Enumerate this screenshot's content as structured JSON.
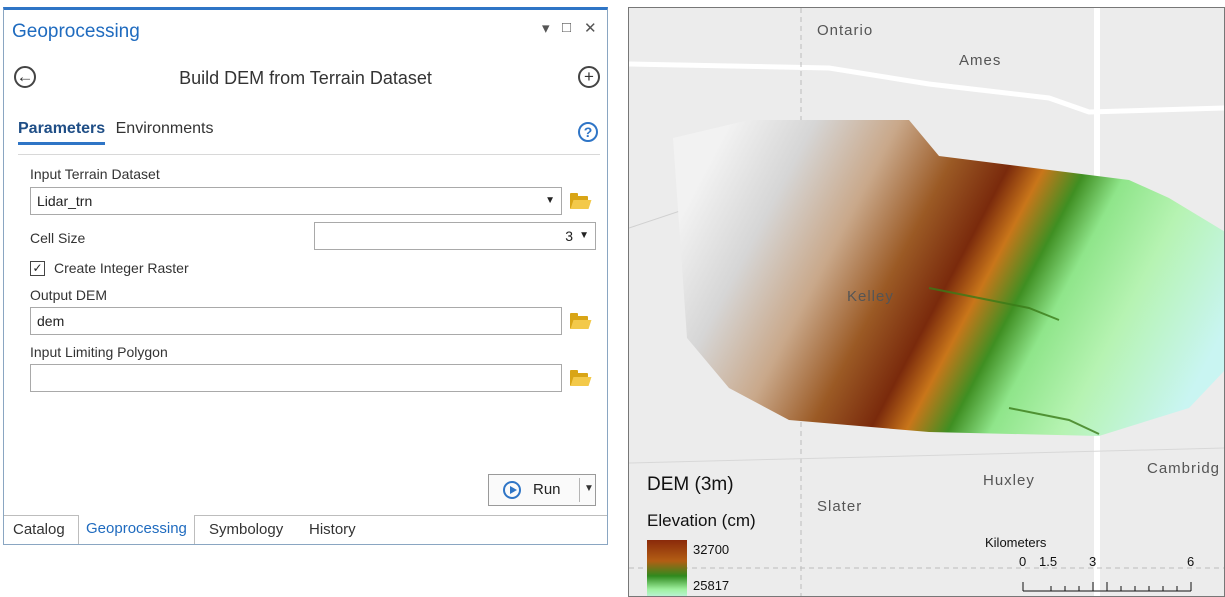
{
  "geoprocessing": {
    "title": "Geoprocessing",
    "window_controls": {
      "dropdown": "▾",
      "maximize": "□",
      "close": "✕"
    },
    "tool_title": "Build DEM from Terrain Dataset",
    "back_icon": "back-arrow-icon",
    "add_icon": "plus-icon",
    "tabs": {
      "parameters": "Parameters",
      "environments": "Environments"
    },
    "help_glyph": "?",
    "params": {
      "input_terrain": {
        "label": "Input Terrain Dataset",
        "value": "Lidar_trn"
      },
      "cell_size": {
        "label": "Cell Size",
        "value": "3"
      },
      "create_integer": {
        "label": "Create Integer Raster",
        "checked": true,
        "check_glyph": "✓"
      },
      "output_dem": {
        "label": "Output DEM",
        "value": "dem"
      },
      "limiting_polygon": {
        "label": "Input Limiting Polygon",
        "value": ""
      }
    },
    "run_label": "Run",
    "bottom_tabs": [
      "Catalog",
      "Geoprocessing",
      "Symbology",
      "History"
    ],
    "active_tab": "Geoprocessing",
    "accent_color": "#2f75c6"
  },
  "map": {
    "places": [
      "Ontario",
      "Ames",
      "Kelley",
      "Huxley",
      "Slater",
      "Cambridg"
    ],
    "legend": {
      "title": "DEM (3m)",
      "subtitle": "Elevation (cm)",
      "high": "32700",
      "low": "25817"
    },
    "scale": {
      "units": "Kilometers",
      "ticks": [
        "0",
        "1.5",
        "3",
        "6"
      ]
    },
    "ramp_colors": [
      "#8a2a0a",
      "#b35e14",
      "#2f8a1e",
      "#9ef09e",
      "#c7f5f0"
    ]
  }
}
